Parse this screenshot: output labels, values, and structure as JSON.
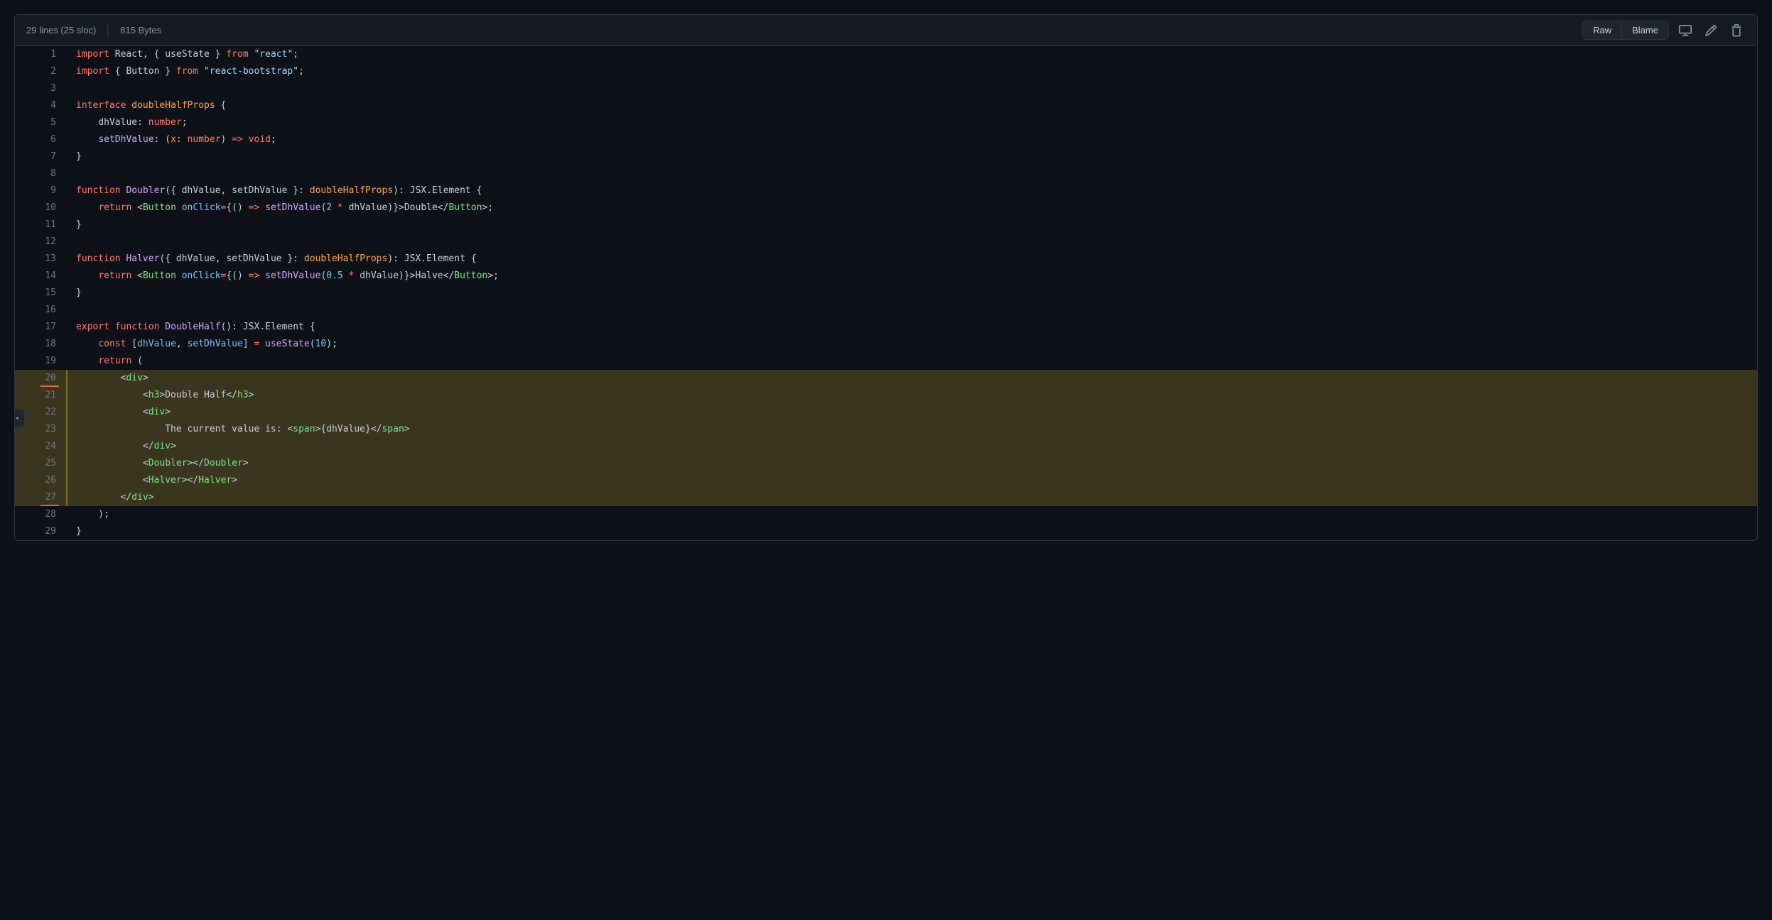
{
  "header": {
    "lines": "29 lines (25 sloc)",
    "bytes": "815 Bytes",
    "raw_label": "Raw",
    "blame_label": "Blame"
  },
  "lines": [
    {
      "n": "1",
      "hl": false,
      "html": "<span class='k-red'>import</span> React, { useState } <span class='k-red'>from</span> <span class='k-lblue'>\"react\"</span>;"
    },
    {
      "n": "2",
      "hl": false,
      "html": "<span class='k-red'>import</span> { Button } <span class='k-red'>from</span> <span class='k-lblue'>\"react-bootstrap\"</span>;"
    },
    {
      "n": "3",
      "hl": false,
      "html": ""
    },
    {
      "n": "4",
      "hl": false,
      "html": "<span class='k-red'>interface</span> <span class='k-orange'>doubleHalfProps</span> {"
    },
    {
      "n": "5",
      "hl": false,
      "html": "    dhValue: <span class='k-red'>number</span>;"
    },
    {
      "n": "6",
      "hl": false,
      "html": "    <span class='k-purple'>setDhValue</span>: (<span class='k-orange'>x</span>: <span class='k-red'>number</span>) <span class='k-red'>=&gt;</span> <span class='k-red'>void</span>;"
    },
    {
      "n": "7",
      "hl": false,
      "html": "}"
    },
    {
      "n": "8",
      "hl": false,
      "html": ""
    },
    {
      "n": "9",
      "hl": false,
      "html": "<span class='k-red'>function</span> <span class='k-purple'>Doubler</span>({ dhValue, setDhValue }: <span class='k-orange'>doubleHalfProps</span>): JSX.Element {"
    },
    {
      "n": "10",
      "hl": false,
      "html": "    <span class='k-red'>return</span> &lt;<span class='k-green'>Button</span> <span class='k-blue'>onClick</span><span class='k-red'>=</span>{() <span class='k-red'>=&gt;</span> <span class='k-purple'>setDhValue</span>(<span class='k-blue'>2</span> <span class='k-red'>*</span> dhValue)}&gt;Double&lt;/<span class='k-green'>Button</span>&gt;;"
    },
    {
      "n": "11",
      "hl": false,
      "html": "}"
    },
    {
      "n": "12",
      "hl": false,
      "html": ""
    },
    {
      "n": "13",
      "hl": false,
      "html": "<span class='k-red'>function</span> <span class='k-purple'>Halver</span>({ dhValue, setDhValue }: <span class='k-orange'>doubleHalfProps</span>): JSX.Element {"
    },
    {
      "n": "14",
      "hl": false,
      "html": "    <span class='k-red'>return</span> &lt;<span class='k-green'>Button</span> <span class='k-blue'>onClick</span><span class='k-red'>=</span>{() <span class='k-red'>=&gt;</span> <span class='k-purple'>setDhValue</span>(<span class='k-blue'>0.5</span> <span class='k-red'>*</span> dhValue)}&gt;Halve&lt;/<span class='k-green'>Button</span>&gt;;"
    },
    {
      "n": "15",
      "hl": false,
      "html": "}"
    },
    {
      "n": "16",
      "hl": false,
      "html": ""
    },
    {
      "n": "17",
      "hl": false,
      "html": "<span class='k-red'>export</span> <span class='k-red'>function</span> <span class='k-purple'>DoubleHalf</span>(): JSX.Element {"
    },
    {
      "n": "18",
      "hl": false,
      "html": "    <span class='k-red'>const</span> [<span class='k-blue'>dhValue</span>, <span class='k-blue'>setDhValue</span>] <span class='k-red'>=</span> <span class='k-purple'>useState</span>(<span class='k-blue'>10</span>);"
    },
    {
      "n": "19",
      "hl": false,
      "html": "    <span class='k-red'>return</span> ("
    },
    {
      "n": "20",
      "hl": true,
      "border": true,
      "html": "        &lt;<span class='k-green'>div</span>&gt;"
    },
    {
      "n": "21",
      "hl": true,
      "html": "            &lt;<span class='k-green'>h3</span>&gt;Double Half&lt;/<span class='k-green'>h3</span>&gt;"
    },
    {
      "n": "22",
      "hl": true,
      "html": "            &lt;<span class='k-green'>div</span>&gt;"
    },
    {
      "n": "23",
      "hl": true,
      "html": "                The current value is: &lt;<span class='k-green'>span</span>&gt;{dhValue}&lt;/<span class='k-green'>span</span>&gt;"
    },
    {
      "n": "24",
      "hl": true,
      "html": "            &lt;/<span class='k-green'>div</span>&gt;"
    },
    {
      "n": "25",
      "hl": true,
      "html": "            &lt;<span class='k-green'>Doubler</span>&gt;&lt;/<span class='k-green'>Doubler</span>&gt;"
    },
    {
      "n": "26",
      "hl": true,
      "html": "            &lt;<span class='k-green'>Halver</span>&gt;&lt;/<span class='k-green'>Halver</span>&gt;"
    },
    {
      "n": "27",
      "hl": true,
      "border": true,
      "html": "        &lt;/<span class='k-green'>div</span>&gt;"
    },
    {
      "n": "28",
      "hl": false,
      "html": "    );"
    },
    {
      "n": "29",
      "hl": false,
      "html": "}"
    }
  ]
}
